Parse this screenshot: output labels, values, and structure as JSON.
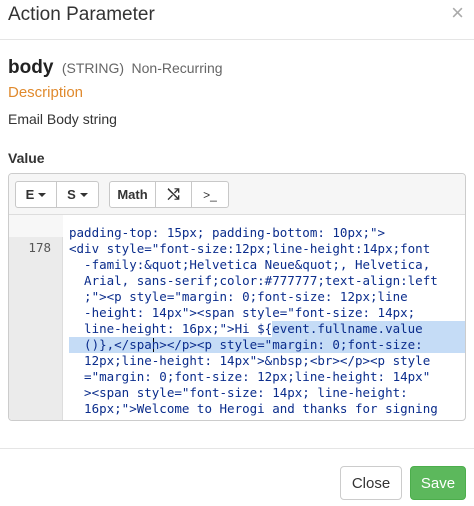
{
  "modal": {
    "title": "Action Parameter",
    "close_icon_glyph": "×"
  },
  "parameter": {
    "name": "body",
    "type": "(STRING)",
    "recurrence": "Non-Recurring",
    "description_label": "Description",
    "description": "Email Body string",
    "value_label": "Value"
  },
  "toolbar": {
    "buttons": [
      {
        "label": "E",
        "icon": "caret-down-icon"
      },
      {
        "label": "S",
        "icon": "caret-down-icon"
      },
      {
        "label": "Math"
      },
      {
        "label": "⤭",
        "icon": "shuffle-icon"
      },
      {
        "label": ">_",
        "icon": "terminal-icon"
      }
    ]
  },
  "editor": {
    "line_number": "178",
    "cut_top_line": "~ ~ ~ ~ ~ ~ ~ ~ ~ ~ ~ ~ ~ ~ ~ ~ ~ ~ ~ ~ ~ ~ ~ ~ ~ ~ ~ ~ ~",
    "code_lines": [
      "padding-top: 15px; padding-bottom: 10px;\">",
      "<div style=\"font-size:12px;line-height:14px;font",
      "  -family:&quot;Helvetica Neue&quot;, Helvetica,",
      "  Arial, sans-serif;color:#777777;text-align:left",
      "  ;\"><p style=\"margin: 0;font-size: 12px;line",
      "  -height: 14px\"><span style=\"font-size: 14px;",
      "  line-height: 16px;\">Hi ${event.fullname.value",
      "  ()},</span></p><p style=\"margin: 0;font-size:",
      "  12px;line-height: 14px\">&nbsp;<br></p><p style",
      "  =\"margin: 0;font-size: 12px;line-height: 14px\"",
      "  ><span style=\"font-size: 14px; line-height:",
      "  16px;\">Welcome to Herogi and thanks for signing"
    ]
  },
  "footer": {
    "close_label": "Close",
    "save_label": "Save"
  },
  "colors": {
    "accent_description": "#e08a2e",
    "save_button": "#5cb85c",
    "code_text": "#0b2d8c",
    "selection": "#c5dcf6"
  }
}
